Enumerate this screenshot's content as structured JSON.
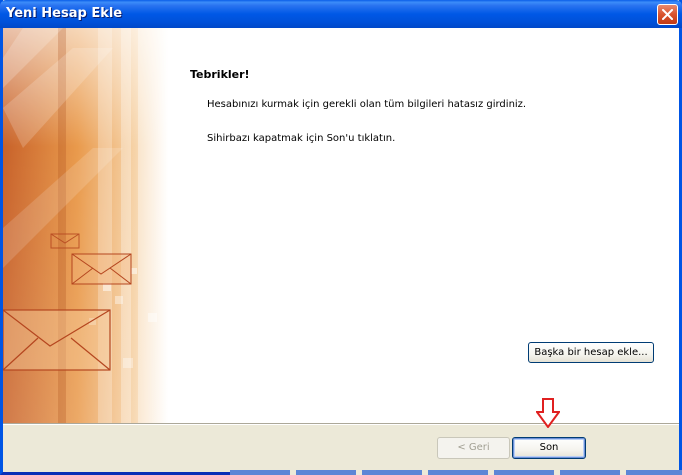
{
  "window": {
    "title": "Yeni Hesap Ekle"
  },
  "main": {
    "heading": "Tebrikler!",
    "message1": "Hesabınızı kurmak için gerekli olan tüm bilgileri hatasız girdiniz.",
    "message2": "Sihirbazı kapatmak için Son'u tıklatın.",
    "add_account_label": "Başka bir hesap ekle..."
  },
  "footer": {
    "back_label": "< Geri",
    "finish_label": "Son"
  },
  "icons": {
    "close": "close-icon",
    "arrow": "red-down-arrow-icon",
    "envelope": "envelope-icon"
  },
  "colors": {
    "titlebar": "#0058e6",
    "accent_orange": "#e08a3c",
    "arrow_red": "#e02020"
  }
}
